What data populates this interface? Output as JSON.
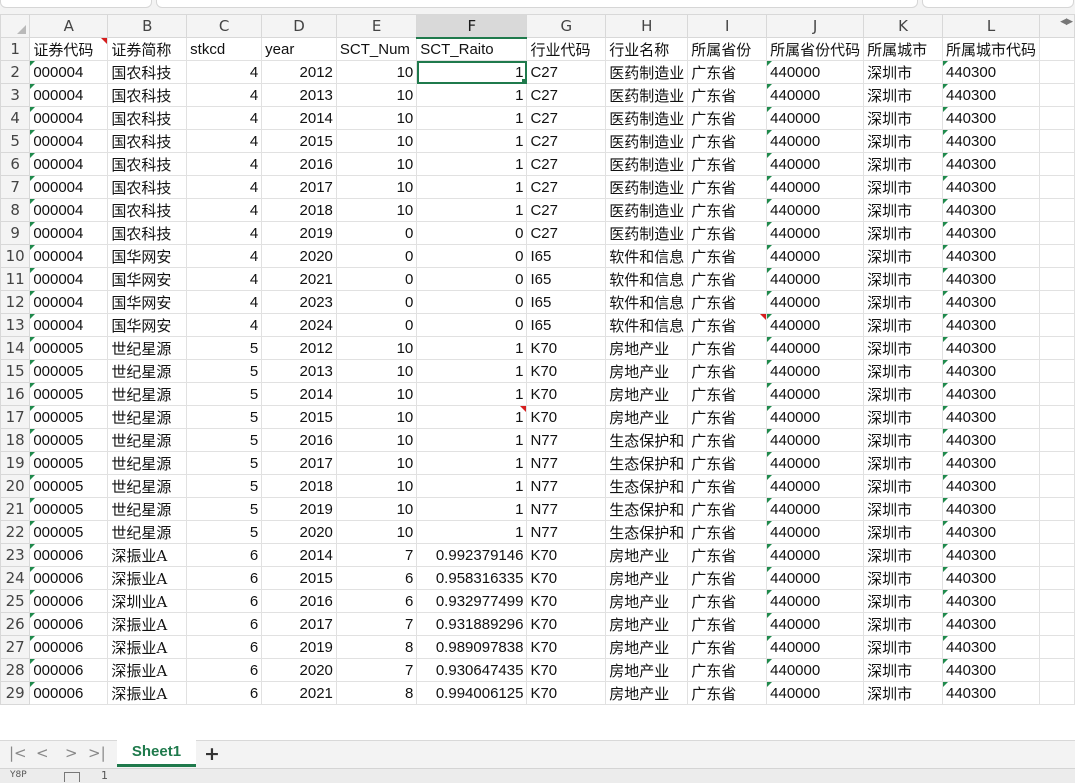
{
  "columns": {
    "letters": [
      "A",
      "B",
      "C",
      "D",
      "E",
      "F",
      "G",
      "H",
      "I",
      "J",
      "K",
      "L"
    ],
    "active": "F"
  },
  "header_row": [
    "证券代码",
    "证券简称",
    "stkcd",
    "year",
    "SCT_Num",
    "SCT_Raito",
    "行业代码",
    "行业名称",
    "所属省份",
    "所属省份代码",
    "所属城市",
    "所属城市代码"
  ],
  "rows": [
    [
      "000004",
      "国农科技",
      "4",
      "2012",
      "10",
      "1",
      "C27",
      "医药制造业",
      "广东省",
      "440000",
      "深圳市",
      "440300"
    ],
    [
      "000004",
      "国农科技",
      "4",
      "2013",
      "10",
      "1",
      "C27",
      "医药制造业",
      "广东省",
      "440000",
      "深圳市",
      "440300"
    ],
    [
      "000004",
      "国农科技",
      "4",
      "2014",
      "10",
      "1",
      "C27",
      "医药制造业",
      "广东省",
      "440000",
      "深圳市",
      "440300"
    ],
    [
      "000004",
      "国农科技",
      "4",
      "2015",
      "10",
      "1",
      "C27",
      "医药制造业",
      "广东省",
      "440000",
      "深圳市",
      "440300"
    ],
    [
      "000004",
      "国农科技",
      "4",
      "2016",
      "10",
      "1",
      "C27",
      "医药制造业",
      "广东省",
      "440000",
      "深圳市",
      "440300"
    ],
    [
      "000004",
      "国农科技",
      "4",
      "2017",
      "10",
      "1",
      "C27",
      "医药制造业",
      "广东省",
      "440000",
      "深圳市",
      "440300"
    ],
    [
      "000004",
      "国农科技",
      "4",
      "2018",
      "10",
      "1",
      "C27",
      "医药制造业",
      "广东省",
      "440000",
      "深圳市",
      "440300"
    ],
    [
      "000004",
      "国农科技",
      "4",
      "2019",
      "0",
      "0",
      "C27",
      "医药制造业",
      "广东省",
      "440000",
      "深圳市",
      "440300"
    ],
    [
      "000004",
      "国华网安",
      "4",
      "2020",
      "0",
      "0",
      "I65",
      "软件和信息",
      "广东省",
      "440000",
      "深圳市",
      "440300"
    ],
    [
      "000004",
      "国华网安",
      "4",
      "2021",
      "0",
      "0",
      "I65",
      "软件和信息",
      "广东省",
      "440000",
      "深圳市",
      "440300"
    ],
    [
      "000004",
      "国华网安",
      "4",
      "2023",
      "0",
      "0",
      "I65",
      "软件和信息",
      "广东省",
      "440000",
      "深圳市",
      "440300"
    ],
    [
      "000004",
      "国华网安",
      "4",
      "2024",
      "0",
      "0",
      "I65",
      "软件和信息",
      "广东省",
      "440000",
      "深圳市",
      "440300"
    ],
    [
      "000005",
      "世纪星源",
      "5",
      "2012",
      "10",
      "1",
      "K70",
      "房地产业",
      "广东省",
      "440000",
      "深圳市",
      "440300"
    ],
    [
      "000005",
      "世纪星源",
      "5",
      "2013",
      "10",
      "1",
      "K70",
      "房地产业",
      "广东省",
      "440000",
      "深圳市",
      "440300"
    ],
    [
      "000005",
      "世纪星源",
      "5",
      "2014",
      "10",
      "1",
      "K70",
      "房地产业",
      "广东省",
      "440000",
      "深圳市",
      "440300"
    ],
    [
      "000005",
      "世纪星源",
      "5",
      "2015",
      "10",
      "1",
      "K70",
      "房地产业",
      "广东省",
      "440000",
      "深圳市",
      "440300"
    ],
    [
      "000005",
      "世纪星源",
      "5",
      "2016",
      "10",
      "1",
      "N77",
      "生态保护和",
      "广东省",
      "440000",
      "深圳市",
      "440300"
    ],
    [
      "000005",
      "世纪星源",
      "5",
      "2017",
      "10",
      "1",
      "N77",
      "生态保护和",
      "广东省",
      "440000",
      "深圳市",
      "440300"
    ],
    [
      "000005",
      "世纪星源",
      "5",
      "2018",
      "10",
      "1",
      "N77",
      "生态保护和",
      "广东省",
      "440000",
      "深圳市",
      "440300"
    ],
    [
      "000005",
      "世纪星源",
      "5",
      "2019",
      "10",
      "1",
      "N77",
      "生态保护和",
      "广东省",
      "440000",
      "深圳市",
      "440300"
    ],
    [
      "000005",
      "世纪星源",
      "5",
      "2020",
      "10",
      "1",
      "N77",
      "生态保护和",
      "广东省",
      "440000",
      "深圳市",
      "440300"
    ],
    [
      "000006",
      "深振业A",
      "6",
      "2014",
      "7",
      "0.992379146",
      "K70",
      "房地产业",
      "广东省",
      "440000",
      "深圳市",
      "440300"
    ],
    [
      "000006",
      "深振业A",
      "6",
      "2015",
      "6",
      "0.958316335",
      "K70",
      "房地产业",
      "广东省",
      "440000",
      "深圳市",
      "440300"
    ],
    [
      "000006",
      "深圳业A",
      "6",
      "2016",
      "6",
      "0.932977499",
      "K70",
      "房地产业",
      "广东省",
      "440000",
      "深圳市",
      "440300"
    ],
    [
      "000006",
      "深振业A",
      "6",
      "2017",
      "7",
      "0.931889296",
      "K70",
      "房地产业",
      "广东省",
      "440000",
      "深圳市",
      "440300"
    ],
    [
      "000006",
      "深振业A",
      "6",
      "2019",
      "8",
      "0.989097838",
      "K70",
      "房地产业",
      "广东省",
      "440000",
      "深圳市",
      "440300"
    ],
    [
      "000006",
      "深振业A",
      "6",
      "2020",
      "7",
      "0.930647435",
      "K70",
      "房地产业",
      "广东省",
      "440000",
      "深圳市",
      "440300"
    ],
    [
      "000006",
      "深振业A",
      "6",
      "2021",
      "8",
      "0.994006125",
      "K70",
      "房地产业",
      "广东省",
      "440000",
      "深圳市",
      "440300"
    ]
  ],
  "sheet_tabs": [
    {
      "label": "Sheet1",
      "active": true
    }
  ],
  "add_sheet_label": "+",
  "nav_buttons": [
    "|<",
    "<",
    ">",
    ">|"
  ],
  "status": {
    "icon_label": "Y8P",
    "page_number": "1"
  },
  "colors": {
    "accent": "#1f7a4c",
    "comment_marker": "#d61e1e",
    "error_marker": "#1f8a4c"
  }
}
